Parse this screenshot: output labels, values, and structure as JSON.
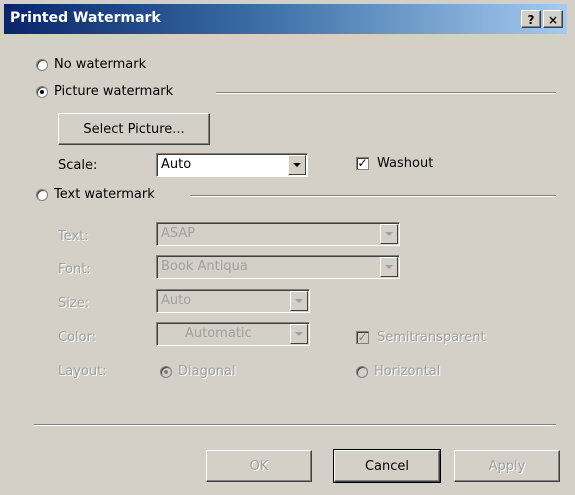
{
  "dialog": {
    "title": "Printed Watermark",
    "help_label": "?",
    "close_label": "×"
  },
  "options": {
    "no_watermark": "No watermark",
    "picture_watermark": "Picture watermark",
    "text_watermark": "Text watermark"
  },
  "picture": {
    "select_button": "Select Picture...",
    "scale_label": "Scale:",
    "scale_value": "Auto",
    "washout_label": "Washout",
    "washout_checked": true
  },
  "text": {
    "text_label": "Text:",
    "text_value": "ASAP",
    "font_label": "Font:",
    "font_value": "Book Antiqua",
    "size_label": "Size:",
    "size_value": "Auto",
    "color_label": "Color:",
    "color_value": "Automatic",
    "semitransparent_label": "Semitransparent",
    "layout_label": "Layout:",
    "diagonal_label": "Diagonal",
    "horizontal_label": "Horizontal"
  },
  "buttons": {
    "ok": "OK",
    "cancel": "Cancel",
    "apply": "Apply"
  }
}
